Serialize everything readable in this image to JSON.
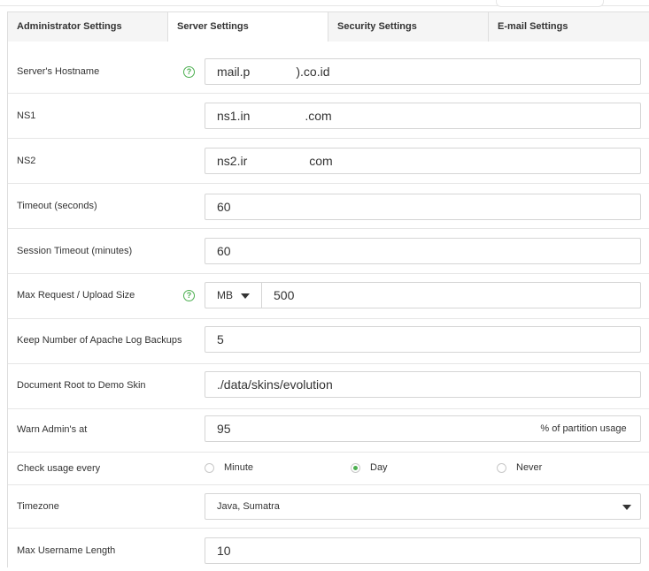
{
  "tabs": [
    {
      "label": "Administrator Settings",
      "active": false
    },
    {
      "label": "Server Settings",
      "active": true
    },
    {
      "label": "Security Settings",
      "active": false
    },
    {
      "label": "E-mail Settings",
      "active": false
    }
  ],
  "fields": {
    "hostname": {
      "label": "Server's Hostname",
      "value_start": "mail.p",
      "value_end": ").co.id"
    },
    "ns1": {
      "label": "NS1",
      "value_start": "ns1.in",
      "value_end": ".com"
    },
    "ns2": {
      "label": "NS2",
      "value_start": "ns2.ir",
      "value_end": "com"
    },
    "timeout": {
      "label": "Timeout (seconds)",
      "value": "60"
    },
    "session_timeout": {
      "label": "Session Timeout (minutes)",
      "value": "60"
    },
    "max_request": {
      "label": "Max Request / Upload Size",
      "unit": "MB",
      "value": "500"
    },
    "apache_backups": {
      "label": "Keep Number of Apache Log Backups",
      "value": "5"
    },
    "doc_root": {
      "label": "Document Root to Demo Skin",
      "value": "./data/skins/evolution"
    },
    "warn_admin": {
      "label": "Warn Admin's at",
      "value": "95",
      "addon": "% of partition usage"
    },
    "check_usage": {
      "label": "Check usage every",
      "options": [
        {
          "label": "Minute",
          "selected": false
        },
        {
          "label": "Day",
          "selected": true
        },
        {
          "label": "Never",
          "selected": false
        }
      ]
    },
    "timezone": {
      "label": "Timezone",
      "value": "Java, Sumatra"
    },
    "max_username": {
      "label": "Max Username Length",
      "value": "10"
    }
  },
  "icons": {
    "help": "help-circle-icon",
    "dropdown": "caret-down-icon"
  },
  "colors": {
    "accent": "#4caf50",
    "border": "#d5d5d5",
    "tab_bg": "#f5f5f5"
  }
}
